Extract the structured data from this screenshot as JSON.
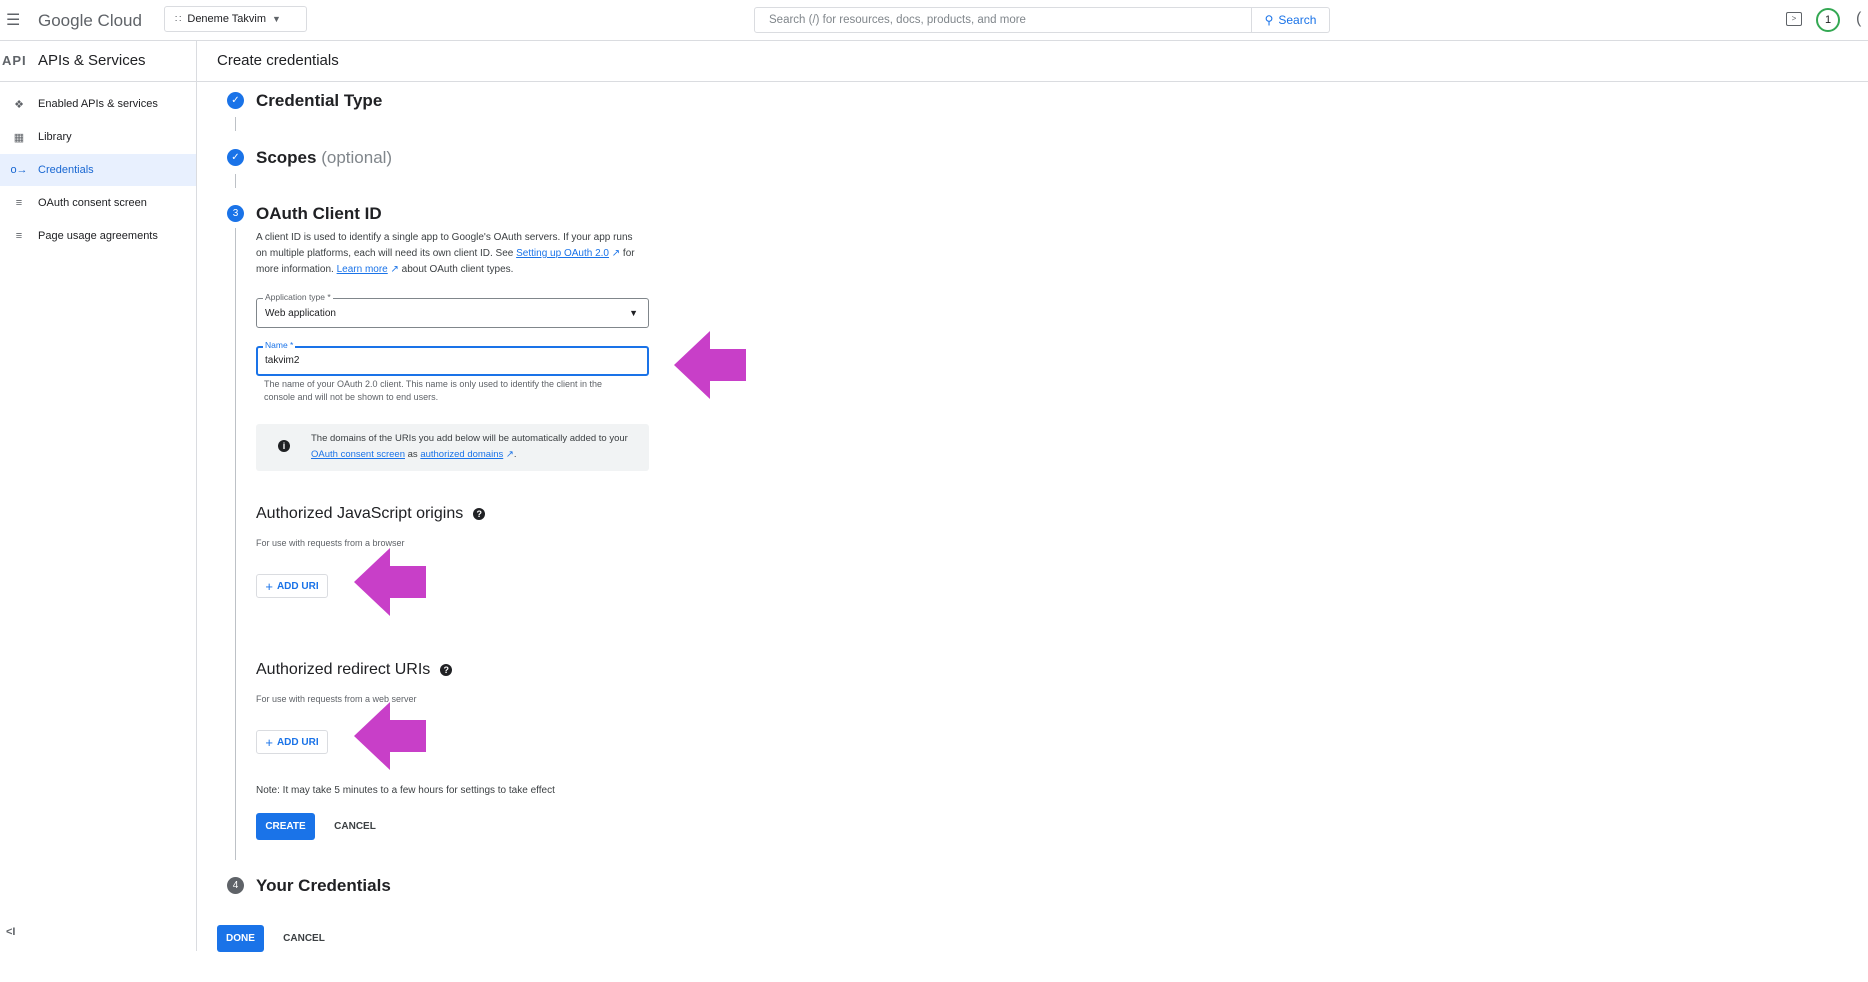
{
  "topbar": {
    "brand": "Google Cloud",
    "project": "Deneme Takvim",
    "search_placeholder": "Search (/) for resources, docs, products, and more",
    "search_button": "Search",
    "notification_count": "1"
  },
  "appbar": {
    "api_logo": "API",
    "section_title": "APIs & Services",
    "page_title": "Create credentials"
  },
  "sidebar": {
    "items": [
      {
        "label": "Enabled APIs & services",
        "icon": "api-icon"
      },
      {
        "label": "Library",
        "icon": "library-icon"
      },
      {
        "label": "Credentials",
        "icon": "key-icon"
      },
      {
        "label": "OAuth consent screen",
        "icon": "consent-icon"
      },
      {
        "label": "Page usage agreements",
        "icon": "agreements-icon"
      }
    ],
    "collapse": "<I"
  },
  "steps": {
    "step1": "Credential Type",
    "step2_main": "Scopes",
    "step2_sub": "(optional)",
    "step3_num": "3",
    "step3": "OAuth Client ID",
    "step4_num": "4",
    "step4": "Your Credentials"
  },
  "oauth": {
    "desc_1": "A client ID is used to identify a single app to Google's OAuth servers. If your app runs on multiple platforms, each will need its own client ID. See ",
    "desc_link1": "Setting up OAuth 2.0",
    "desc_2": " for more information. ",
    "desc_link2": "Learn more",
    "desc_3": " about OAuth client types.",
    "app_type_label": "Application type *",
    "app_type_value": "Web application",
    "name_label": "Name *",
    "name_value": "takvim2",
    "name_hint": "The name of your OAuth 2.0 client. This name is only used to identify the client in the console and will not be shown to end users.",
    "info_1": "The domains of the URIs you add below will be automatically added to your ",
    "info_link1": "OAuth consent screen",
    "info_2": " as ",
    "info_link2": "authorized domains",
    "info_3": ".",
    "js_title": "Authorized JavaScript origins",
    "js_sub": "For use with requests from a browser",
    "add_uri": "ADD URI",
    "redirect_title": "Authorized redirect URIs",
    "redirect_sub": "For use with requests from a web server",
    "note": "Note: It may take 5 minutes to a few hours for settings to take effect",
    "create": "CREATE",
    "cancel": "CANCEL"
  },
  "footer": {
    "done": "DONE",
    "cancel": "CANCEL"
  },
  "colors": {
    "accent": "#1a73e8",
    "annotation_arrow": "#c83fc8"
  }
}
